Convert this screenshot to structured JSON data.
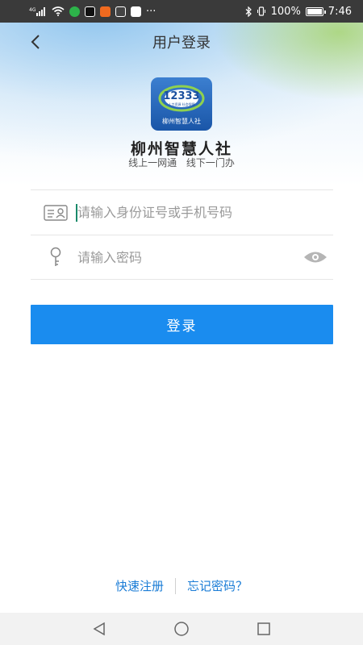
{
  "status_bar": {
    "network": "4G",
    "battery_text": "100%",
    "time": "7:46",
    "more": "···"
  },
  "header": {
    "title": "用户登录"
  },
  "logo": {
    "number": "12333",
    "tagline": "人力资源 社会保障",
    "caption": "柳州智慧人社"
  },
  "app": {
    "name": "柳州智慧人社",
    "slogan": "线上一网通 线下一门办"
  },
  "form": {
    "id_placeholder": "请输入身份证号或手机号码",
    "id_value": "",
    "password_placeholder": "请输入密码",
    "password_value": ""
  },
  "login_button": "登录",
  "links": {
    "register": "快速注册",
    "forgot": "忘记密码？"
  },
  "colors": {
    "primary": "#1a8cef",
    "link": "#1a7cd6",
    "status_bar": "#3a3a3a"
  }
}
